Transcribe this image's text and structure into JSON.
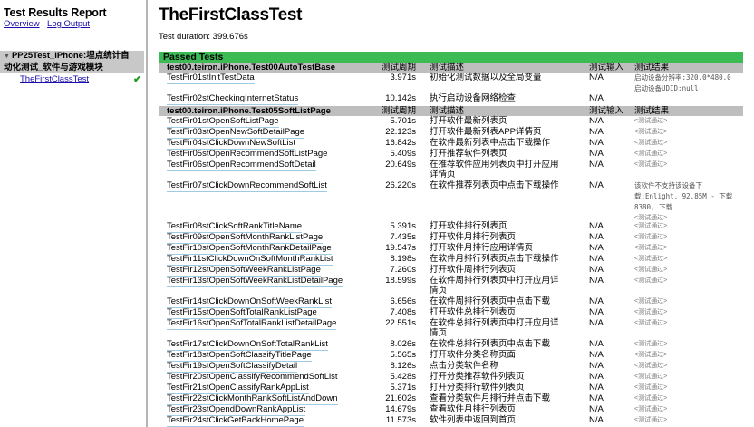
{
  "sidebar": {
    "title": "Test Results Report",
    "overview_link": "Overview",
    "separator": "·",
    "log_link": "Log Output",
    "suite_line1": "PP25Test_iPhone:埋点统计自",
    "suite_line2": "动化测试_软件与游戏模块",
    "selected_case": "TheFirstClassTest",
    "check_mark": "✔"
  },
  "main": {
    "title": "TheFirstClassTest",
    "duration": "Test duration: 399.676s",
    "section": "Passed Tests",
    "columns": {
      "duration": "测试周期",
      "desc": "测试描述",
      "input": "测试输入",
      "result": "测试结果"
    },
    "groups": [
      {
        "name": "test00.teiron.iPhone.Test00AutoTestBase",
        "rows": [
          {
            "name": "TestFir01stInitTestData",
            "dur": "3.971s",
            "desc": "初始化测试数据以及全局变量",
            "in": "N/A",
            "res": [
              "启动设备分辨率:320.0*480.0",
              "启动设备UDID:null"
            ]
          },
          {
            "name": "TestFir02stCheckingInternetStatus",
            "dur": "10.142s",
            "desc": "执行启动设备网络检查",
            "in": "N/A",
            "res": []
          }
        ]
      },
      {
        "name": "test00.teiron.iPhone.Test05SoftListPage",
        "rows": [
          {
            "name": "TestFir01stOpenSoftListPage",
            "dur": "5.701s",
            "desc": "打开软件最新列表页",
            "in": "N/A",
            "res": [
              "<测试通过>"
            ]
          },
          {
            "name": "TestFir03stOpenNewSoftDetailPage",
            "dur": "22.123s",
            "desc": "打开软件最新列表APP详情页",
            "in": "N/A",
            "res": [
              "<测试通过>"
            ]
          },
          {
            "name": "TestFir04stClickDownNewSoftList",
            "dur": "16.842s",
            "desc": "在软件最新列表中点击下载操作",
            "in": "N/A",
            "res": [
              "<测试通过>"
            ]
          },
          {
            "name": "TestFir05stOpenRecommendSoftListPage",
            "dur": "5.409s",
            "desc": "打开推荐软件列表页",
            "in": "N/A",
            "res": [
              "<测试通过>"
            ]
          },
          {
            "name": "TestFir06stOpenRecommendSoftDetail",
            "dur": "20.649s",
            "desc": "在推荐软件应用列表页中打开应用详情页",
            "in": "N/A",
            "res": [
              "<测试通过>"
            ]
          },
          {
            "name": "TestFir07stClickDownRecommendSoftList",
            "dur": "26.220s",
            "desc": "在软件推荐列表页中点击下载操作",
            "in": "N/A",
            "res": [
              "该软件不支持该设备下",
              "载:Enlight, 92.85M - 下载",
              "8380, 下载",
              "<测试通过>"
            ]
          },
          {
            "name": "TestFir08stClickSoftRankTitleName",
            "dur": "5.391s",
            "desc": "打开软件排行列表页",
            "in": "N/A",
            "res": [
              "<测试通过>"
            ]
          },
          {
            "name": "TestFir09stOpenSoftMonthRankListPage",
            "dur": "7.435s",
            "desc": "打开软件月排行列表页",
            "in": "N/A",
            "res": [
              "<测试通过>"
            ]
          },
          {
            "name": "TestFir10stOpenSoftMonthRankDetailPage",
            "dur": "19.547s",
            "desc": "打开软件月排行应用详情页",
            "in": "N/A",
            "res": [
              "<测试通过>"
            ]
          },
          {
            "name": "TestFir11stClickDownOnSoftMonthRankList",
            "dur": "8.198s",
            "desc": "在软件月排行列表页点击下载操作",
            "in": "N/A",
            "res": [
              "<测试通过>"
            ]
          },
          {
            "name": "TestFir12stOpenSoftWeekRankListPage",
            "dur": "7.260s",
            "desc": "打开软件周排行列表页",
            "in": "N/A",
            "res": [
              "<测试通过>"
            ]
          },
          {
            "name": "TestFir13stOpenSoftWeekRankListDetailPage",
            "dur": "18.599s",
            "desc": "在软件周排行列表页中打开应用详情页",
            "in": "N/A",
            "res": [
              "<测试通过>"
            ]
          },
          {
            "name": "TestFir14stClickDownOnSoftWeekRankList",
            "dur": "6.656s",
            "desc": "在软件周排行列表页中点击下载",
            "in": "N/A",
            "res": [
              "<测试通过>"
            ]
          },
          {
            "name": "TestFir15stOpenSoftTotalRankListPage",
            "dur": "7.408s",
            "desc": "打开软件总排行列表页",
            "in": "N/A",
            "res": [
              "<测试通过>"
            ]
          },
          {
            "name": "TestFir16stOpenSofTotalRankListDetailPage",
            "dur": "22.551s",
            "desc": "在软件总排行列表页中打开应用详情页",
            "in": "N/A",
            "res": [
              "<测试通过>"
            ]
          },
          {
            "name": "TestFir17stClickDownOnSoftTotalRankList",
            "dur": "8.026s",
            "desc": "在软件总排行列表页中点击下载",
            "in": "N/A",
            "res": [
              "<测试通过>"
            ]
          },
          {
            "name": "TestFir18stOpenSoftClassifyTitlePage",
            "dur": "5.565s",
            "desc": "打开软件分类名称页面",
            "in": "N/A",
            "res": [
              "<测试通过>"
            ]
          },
          {
            "name": "TestFir19stOpenSoftClassifyDetail",
            "dur": "8.126s",
            "desc": "点击分类软件名称",
            "in": "N/A",
            "res": [
              "<测试通过>"
            ]
          },
          {
            "name": "TestFir20stOpenClassifyRecommendSoftList",
            "dur": "5.428s",
            "desc": "打开分类推荐软件列表页",
            "in": "N/A",
            "res": [
              "<测试通过>"
            ]
          },
          {
            "name": "TestFir21stOpenClassifyRankAppList",
            "dur": "5.371s",
            "desc": "打开分类排行软件列表页",
            "in": "N/A",
            "res": [
              "<测试通过>"
            ]
          },
          {
            "name": "TestFir22stClickMonthRankSoftListAndDown",
            "dur": "21.602s",
            "desc": "查看分类软件月排行并点击下载",
            "in": "N/A",
            "res": [
              "<测试通过>"
            ]
          },
          {
            "name": "TestFir23stOpendDownRankAppList",
            "dur": "14.679s",
            "desc": "查看软件月排行列表页",
            "in": "N/A",
            "res": [
              "<测试通过>"
            ]
          },
          {
            "name": "TestFir24stClickGetBackHomePage",
            "dur": "11.573s",
            "desc": "软件列表中返回到首页",
            "in": "N/A",
            "res": [
              "<测试通过>"
            ]
          }
        ]
      }
    ]
  }
}
